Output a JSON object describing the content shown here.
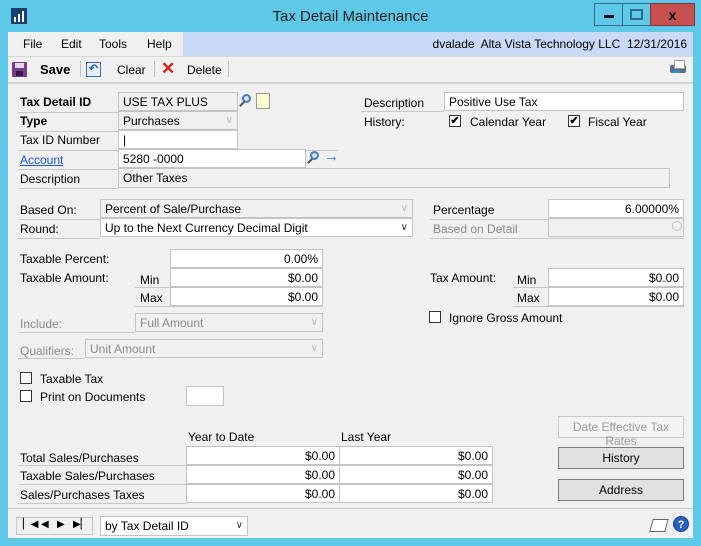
{
  "window": {
    "title": "Tax Detail Maintenance",
    "minimize_glyph": "—",
    "maximize_glyph": "□",
    "close_glyph": "x"
  },
  "menu": {
    "items": [
      "File",
      "Edit",
      "Tools",
      "Help"
    ],
    "user": "dvalade",
    "company": "Alta Vista Technology LLC",
    "date": "12/31/2016"
  },
  "toolbar": {
    "save_label": "Save",
    "clear_label": "Clear",
    "delete_label": "Delete"
  },
  "header": {
    "tax_detail_id_label": "Tax Detail ID",
    "tax_detail_id_value": "USE TAX PLUS",
    "type_label": "Type",
    "type_value": "Purchases",
    "tax_id_number_label": "Tax ID Number",
    "tax_id_number_value": "|",
    "account_label": "Account",
    "account_value": "5280 -0000",
    "description_label": "Description",
    "description_value": "Other Taxes",
    "right_description_label": "Description",
    "right_description_value": "Positive Use Tax",
    "history_label": "History:",
    "calendar_year_label": "Calendar Year",
    "calendar_year_checked": true,
    "fiscal_year_label": "Fiscal Year",
    "fiscal_year_checked": true
  },
  "calc": {
    "based_on_label": "Based On:",
    "based_on_value": "Percent of Sale/Purchase",
    "round_label": "Round:",
    "round_value": "Up to the Next Currency Decimal Digit",
    "percentage_label": "Percentage",
    "percentage_value": "6.00000%",
    "based_on_detail_label": "Based on Detail",
    "based_on_detail_value": "",
    "taxable_percent_label": "Taxable Percent:",
    "taxable_percent_value": "0.00%",
    "taxable_amount_label": "Taxable Amount:",
    "min_label": "Min",
    "max_label": "Max",
    "taxable_min": "$0.00",
    "taxable_max": "$0.00",
    "tax_amount_label": "Tax Amount:",
    "tax_min": "$0.00",
    "tax_max": "$0.00",
    "ignore_gross_label": "Ignore Gross Amount",
    "ignore_gross_checked": false,
    "include_label": "Include:",
    "include_value": "Full Amount",
    "qualifiers_label": "Qualifiers:",
    "qualifiers_value": "Unit Amount",
    "taxable_tax_label": "Taxable Tax",
    "taxable_tax_checked": false,
    "print_on_docs_label": "Print on Documents",
    "print_on_docs_checked": false,
    "print_on_docs_value": ""
  },
  "totals": {
    "col_ytd": "Year to Date",
    "col_last_year": "Last Year",
    "rows": [
      {
        "label": "Total Sales/Purchases",
        "ytd": "$0.00",
        "last": "$0.00"
      },
      {
        "label": "Taxable Sales/Purchases",
        "ytd": "$0.00",
        "last": "$0.00"
      },
      {
        "label": "Sales/Purchases Taxes",
        "ytd": "$0.00",
        "last": "$0.00"
      }
    ]
  },
  "buttons": {
    "date_effective": "Date Effective Tax Rates",
    "history": "History",
    "address": "Address"
  },
  "status": {
    "sort_by": "by Tax Detail ID"
  }
}
